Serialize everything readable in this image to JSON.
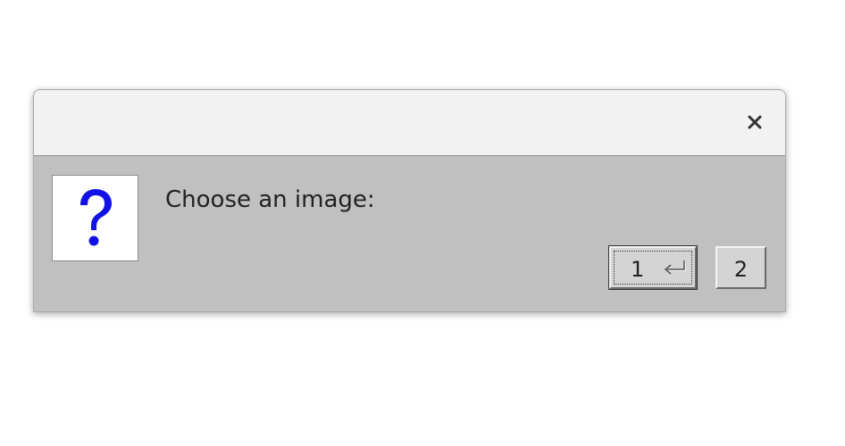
{
  "dialog": {
    "close_icon": "close-icon",
    "question_icon": "question-mark-icon",
    "question_color": "#1212e6",
    "message": "Choose an image:",
    "buttons": [
      {
        "label": "1",
        "default": true,
        "icon": "enter-key-icon"
      },
      {
        "label": "2",
        "default": false
      }
    ]
  }
}
